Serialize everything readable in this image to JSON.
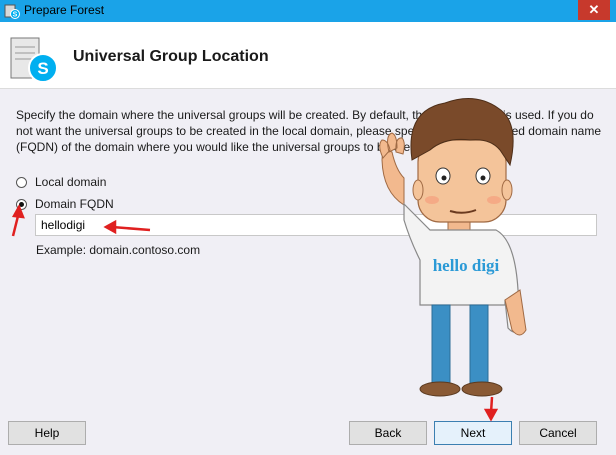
{
  "window": {
    "title": "Prepare Forest",
    "close_glyph": "✕",
    "titlebar_color": "#1aa3e8"
  },
  "header": {
    "title": "Universal Group Location",
    "icon": "skype-server-icon",
    "accent": "#00aff0"
  },
  "main": {
    "description": "Specify the domain where the universal groups will be created. By default, the local domain is used. If you do not want the universal groups to be created in the local domain, please specify the fully qualified domain name (FQDN) of the domain where you would like the universal groups to be created.",
    "options": [
      {
        "label": "Local domain",
        "selected": false
      },
      {
        "label": "Domain FQDN",
        "selected": true
      }
    ],
    "fqdn_value": "hellodigi",
    "example": "Example: domain.contoso.com"
  },
  "footer": {
    "help_label": "Help",
    "back_label": "Back",
    "next_label": "Next",
    "cancel_label": "Cancel"
  },
  "overlay": {
    "mascot_text": "hello digi",
    "arrow_color": "#e02020"
  }
}
